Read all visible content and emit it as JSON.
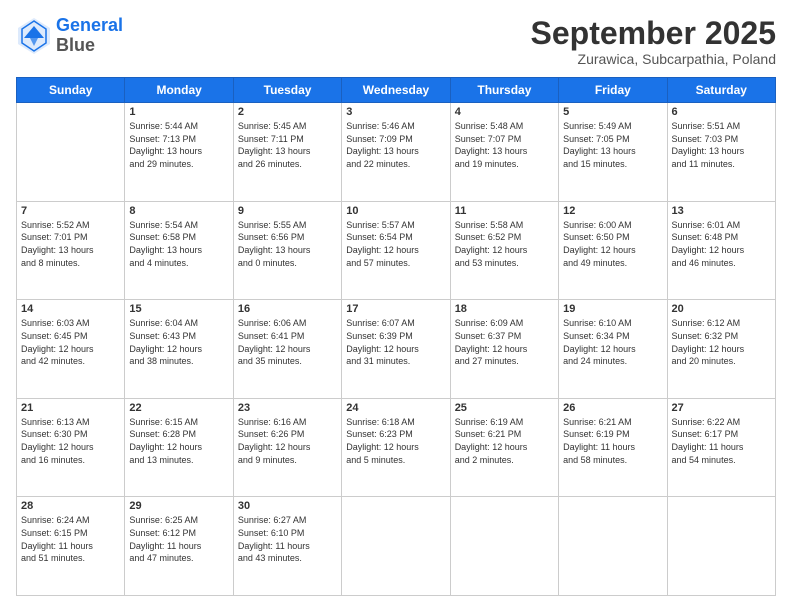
{
  "logo": {
    "line1": "General",
    "line2": "Blue"
  },
  "header": {
    "month": "September 2025",
    "location": "Zurawica, Subcarpathia, Poland"
  },
  "days": [
    "Sunday",
    "Monday",
    "Tuesday",
    "Wednesday",
    "Thursday",
    "Friday",
    "Saturday"
  ],
  "weeks": [
    [
      {
        "day": "",
        "content": ""
      },
      {
        "day": "1",
        "content": "Sunrise: 5:44 AM\nSunset: 7:13 PM\nDaylight: 13 hours\nand 29 minutes."
      },
      {
        "day": "2",
        "content": "Sunrise: 5:45 AM\nSunset: 7:11 PM\nDaylight: 13 hours\nand 26 minutes."
      },
      {
        "day": "3",
        "content": "Sunrise: 5:46 AM\nSunset: 7:09 PM\nDaylight: 13 hours\nand 22 minutes."
      },
      {
        "day": "4",
        "content": "Sunrise: 5:48 AM\nSunset: 7:07 PM\nDaylight: 13 hours\nand 19 minutes."
      },
      {
        "day": "5",
        "content": "Sunrise: 5:49 AM\nSunset: 7:05 PM\nDaylight: 13 hours\nand 15 minutes."
      },
      {
        "day": "6",
        "content": "Sunrise: 5:51 AM\nSunset: 7:03 PM\nDaylight: 13 hours\nand 11 minutes."
      }
    ],
    [
      {
        "day": "7",
        "content": "Sunrise: 5:52 AM\nSunset: 7:01 PM\nDaylight: 13 hours\nand 8 minutes."
      },
      {
        "day": "8",
        "content": "Sunrise: 5:54 AM\nSunset: 6:58 PM\nDaylight: 13 hours\nand 4 minutes."
      },
      {
        "day": "9",
        "content": "Sunrise: 5:55 AM\nSunset: 6:56 PM\nDaylight: 13 hours\nand 0 minutes."
      },
      {
        "day": "10",
        "content": "Sunrise: 5:57 AM\nSunset: 6:54 PM\nDaylight: 12 hours\nand 57 minutes."
      },
      {
        "day": "11",
        "content": "Sunrise: 5:58 AM\nSunset: 6:52 PM\nDaylight: 12 hours\nand 53 minutes."
      },
      {
        "day": "12",
        "content": "Sunrise: 6:00 AM\nSunset: 6:50 PM\nDaylight: 12 hours\nand 49 minutes."
      },
      {
        "day": "13",
        "content": "Sunrise: 6:01 AM\nSunset: 6:48 PM\nDaylight: 12 hours\nand 46 minutes."
      }
    ],
    [
      {
        "day": "14",
        "content": "Sunrise: 6:03 AM\nSunset: 6:45 PM\nDaylight: 12 hours\nand 42 minutes."
      },
      {
        "day": "15",
        "content": "Sunrise: 6:04 AM\nSunset: 6:43 PM\nDaylight: 12 hours\nand 38 minutes."
      },
      {
        "day": "16",
        "content": "Sunrise: 6:06 AM\nSunset: 6:41 PM\nDaylight: 12 hours\nand 35 minutes."
      },
      {
        "day": "17",
        "content": "Sunrise: 6:07 AM\nSunset: 6:39 PM\nDaylight: 12 hours\nand 31 minutes."
      },
      {
        "day": "18",
        "content": "Sunrise: 6:09 AM\nSunset: 6:37 PM\nDaylight: 12 hours\nand 27 minutes."
      },
      {
        "day": "19",
        "content": "Sunrise: 6:10 AM\nSunset: 6:34 PM\nDaylight: 12 hours\nand 24 minutes."
      },
      {
        "day": "20",
        "content": "Sunrise: 6:12 AM\nSunset: 6:32 PM\nDaylight: 12 hours\nand 20 minutes."
      }
    ],
    [
      {
        "day": "21",
        "content": "Sunrise: 6:13 AM\nSunset: 6:30 PM\nDaylight: 12 hours\nand 16 minutes."
      },
      {
        "day": "22",
        "content": "Sunrise: 6:15 AM\nSunset: 6:28 PM\nDaylight: 12 hours\nand 13 minutes."
      },
      {
        "day": "23",
        "content": "Sunrise: 6:16 AM\nSunset: 6:26 PM\nDaylight: 12 hours\nand 9 minutes."
      },
      {
        "day": "24",
        "content": "Sunrise: 6:18 AM\nSunset: 6:23 PM\nDaylight: 12 hours\nand 5 minutes."
      },
      {
        "day": "25",
        "content": "Sunrise: 6:19 AM\nSunset: 6:21 PM\nDaylight: 12 hours\nand 2 minutes."
      },
      {
        "day": "26",
        "content": "Sunrise: 6:21 AM\nSunset: 6:19 PM\nDaylight: 11 hours\nand 58 minutes."
      },
      {
        "day": "27",
        "content": "Sunrise: 6:22 AM\nSunset: 6:17 PM\nDaylight: 11 hours\nand 54 minutes."
      }
    ],
    [
      {
        "day": "28",
        "content": "Sunrise: 6:24 AM\nSunset: 6:15 PM\nDaylight: 11 hours\nand 51 minutes."
      },
      {
        "day": "29",
        "content": "Sunrise: 6:25 AM\nSunset: 6:12 PM\nDaylight: 11 hours\nand 47 minutes."
      },
      {
        "day": "30",
        "content": "Sunrise: 6:27 AM\nSunset: 6:10 PM\nDaylight: 11 hours\nand 43 minutes."
      },
      {
        "day": "",
        "content": ""
      },
      {
        "day": "",
        "content": ""
      },
      {
        "day": "",
        "content": ""
      },
      {
        "day": "",
        "content": ""
      }
    ]
  ]
}
